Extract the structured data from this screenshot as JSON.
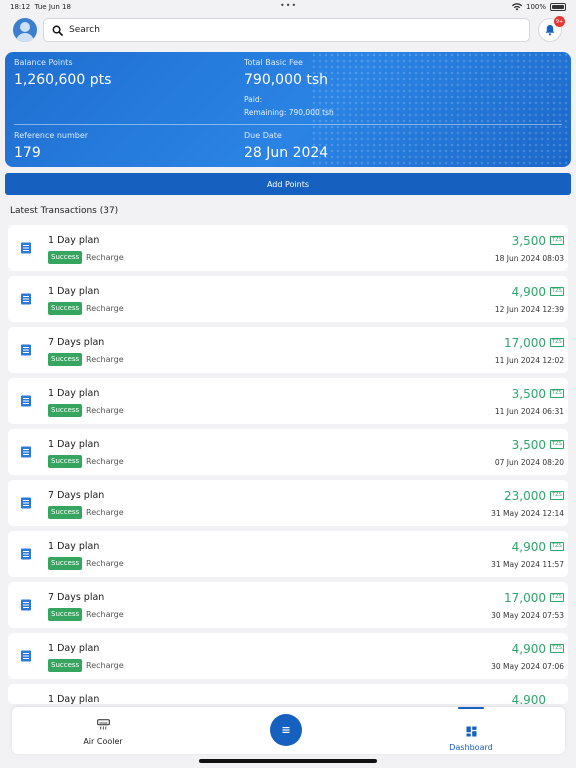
{
  "status_bar": {
    "time": "18:12",
    "date": "Tue Jun 18",
    "battery": "100%"
  },
  "header": {
    "search_placeholder": "Search",
    "notification_count": "9+"
  },
  "balance_card": {
    "balance_label": "Balance Points",
    "balance_value": "1,260,600 pts",
    "fee_label": "Total Basic Fee",
    "fee_value": "790,000 tsh",
    "paid_label": "Paid:",
    "remaining_label": "Remaining: 790,000 tsh",
    "reference_label": "Reference number",
    "reference_value": "179",
    "due_label": "Due Date",
    "due_value": "28 Jun 2024"
  },
  "add_points_label": "Add Points",
  "transactions_title": "Latest Transactions (37)",
  "transactions": [
    {
      "name": "1 Day plan",
      "status": "Success",
      "type": "Recharge",
      "amount": "3,500",
      "currency": "TZS",
      "date": "18 Jun 2024 08:03"
    },
    {
      "name": "1 Day plan",
      "status": "Success",
      "type": "Recharge",
      "amount": "4,900",
      "currency": "TZS",
      "date": "12 Jun 2024 12:39"
    },
    {
      "name": "7 Days plan",
      "status": "Success",
      "type": "Recharge",
      "amount": "17,000",
      "currency": "TZS",
      "date": "11 Jun 2024 12:02"
    },
    {
      "name": "1 Day plan",
      "status": "Success",
      "type": "Recharge",
      "amount": "3,500",
      "currency": "TZS",
      "date": "11 Jun 2024 06:31"
    },
    {
      "name": "1 Day plan",
      "status": "Success",
      "type": "Recharge",
      "amount": "3,500",
      "currency": "TZS",
      "date": "07 Jun 2024 08:20"
    },
    {
      "name": "7 Days plan",
      "status": "Success",
      "type": "Recharge",
      "amount": "23,000",
      "currency": "TZS",
      "date": "31 May 2024 12:14"
    },
    {
      "name": "1 Day plan",
      "status": "Success",
      "type": "Recharge",
      "amount": "4,900",
      "currency": "TZS",
      "date": "31 May 2024 11:57"
    },
    {
      "name": "7 Days plan",
      "status": "Success",
      "type": "Recharge",
      "amount": "17,000",
      "currency": "TZS",
      "date": "30 May 2024 07:53"
    },
    {
      "name": "1 Day plan",
      "status": "Success",
      "type": "Recharge",
      "amount": "4,900",
      "currency": "TZS",
      "date": "30 May 2024 07:06"
    },
    {
      "name": "1 Day plan",
      "status": "",
      "type": "",
      "amount": "4,900",
      "currency": "",
      "date": ""
    }
  ],
  "bottom_nav": {
    "left_label": "Air Cooler",
    "right_label": "Dashboard"
  },
  "colors": {
    "primary": "#1660c0",
    "card_blue": "#2b84e4",
    "success": "#35a55f",
    "amount_green": "#2fa56a"
  }
}
